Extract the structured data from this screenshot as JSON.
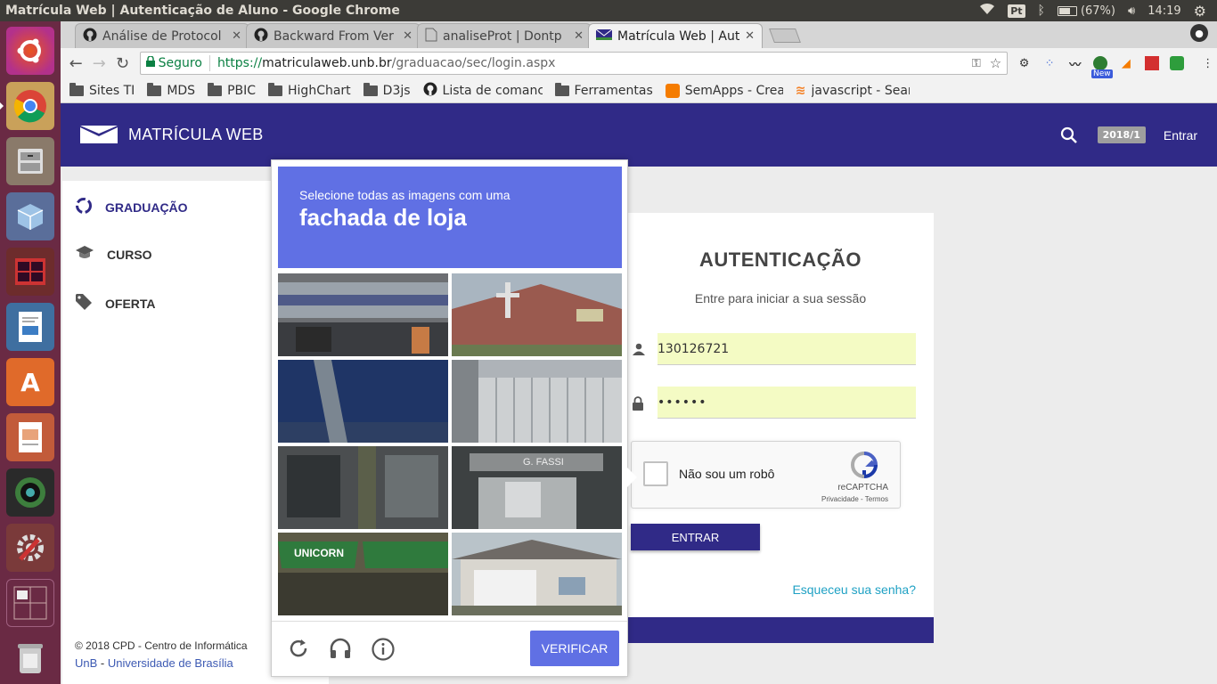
{
  "system": {
    "window_title": "Matrícula Web | Autenticação de Aluno - Google Chrome",
    "keyboard": "Pt",
    "battery": "(67%)",
    "clock": "14:19"
  },
  "launcher": {
    "items": [
      "ubuntu-icon",
      "chrome-icon",
      "files-icon",
      "virtualbox-icon",
      "terminal-icon",
      "writer-icon",
      "software-center-icon",
      "impress-icon",
      "webcam-icon",
      "settings-icon",
      "workspaces-icon",
      "trash-icon"
    ]
  },
  "tabs": [
    {
      "label": "Análise de Protocol",
      "icon": "github-icon"
    },
    {
      "label": "Backward From Ver",
      "icon": "github-icon"
    },
    {
      "label": "analiseProt | Dontp",
      "icon": "document-icon"
    },
    {
      "label": "Matrícula Web | Aut",
      "icon": "envelope-icon"
    }
  ],
  "toolbar": {
    "secure_label": "Seguro",
    "url_scheme": "https://",
    "url_host": "matriculaweb.unb.br",
    "url_path": "/graduacao/sec/login.aspx",
    "ext_new_badge": "New"
  },
  "bookmarks": [
    {
      "label": "Sites TI",
      "icon": "folder"
    },
    {
      "label": "MDS",
      "icon": "folder"
    },
    {
      "label": "PBIC",
      "icon": "folder"
    },
    {
      "label": "HighChart",
      "icon": "folder"
    },
    {
      "label": "D3js",
      "icon": "folder"
    },
    {
      "label": "Lista de comanc",
      "icon": "github"
    },
    {
      "label": "Ferramentas",
      "icon": "folder"
    },
    {
      "label": "SemApps - Creat",
      "icon": "blogger"
    },
    {
      "label": "javascript - Sear",
      "icon": "stackoverflow"
    }
  ],
  "header": {
    "brand": "MATRÍCULA WEB",
    "semester": "2018/1",
    "login_link": "Entrar"
  },
  "sidebar": {
    "items": [
      {
        "label": "GRADUAÇÃO"
      },
      {
        "label": "CURSO"
      },
      {
        "label": "OFERTA"
      }
    ],
    "footer_line1": "© 2018 CPD - Centro de Informática",
    "footer_link1": "UnB",
    "footer_sep": " - ",
    "footer_link2": "Universidade de Brasília"
  },
  "login": {
    "title": "AUTENTICAÇÃO",
    "subtitle": "Entre para iniciar a sua sessão",
    "username": "130126721",
    "password": "••••••",
    "recaptcha_label": "Não sou um robô",
    "recaptcha_brand": "reCAPTCHA",
    "recaptcha_links": "Privacidade - Termos",
    "submit": "ENTRAR",
    "forgot": "Esqueceu sua senha?"
  },
  "challenge": {
    "instruction": "Selecione todas as imagens com uma",
    "target": "fachada de loja",
    "tiles": [
      "street with bus and McDonald's sign",
      "brick church building",
      "dark blue wall with pole",
      "white siding wall",
      "store front with windows",
      "G. FASSI shop window",
      "UNICORN green awnings store",
      "house with garage door"
    ],
    "tile_texts": {
      "tile_6": "UNICORN",
      "tile_5": "G. FASSI"
    },
    "verify_button": "VERIFICAR"
  },
  "colors": {
    "brand": "#302a87",
    "captcha_blue": "#6070e4",
    "link": "#1fa1c4",
    "field_autofill": "#f4fbc4"
  }
}
